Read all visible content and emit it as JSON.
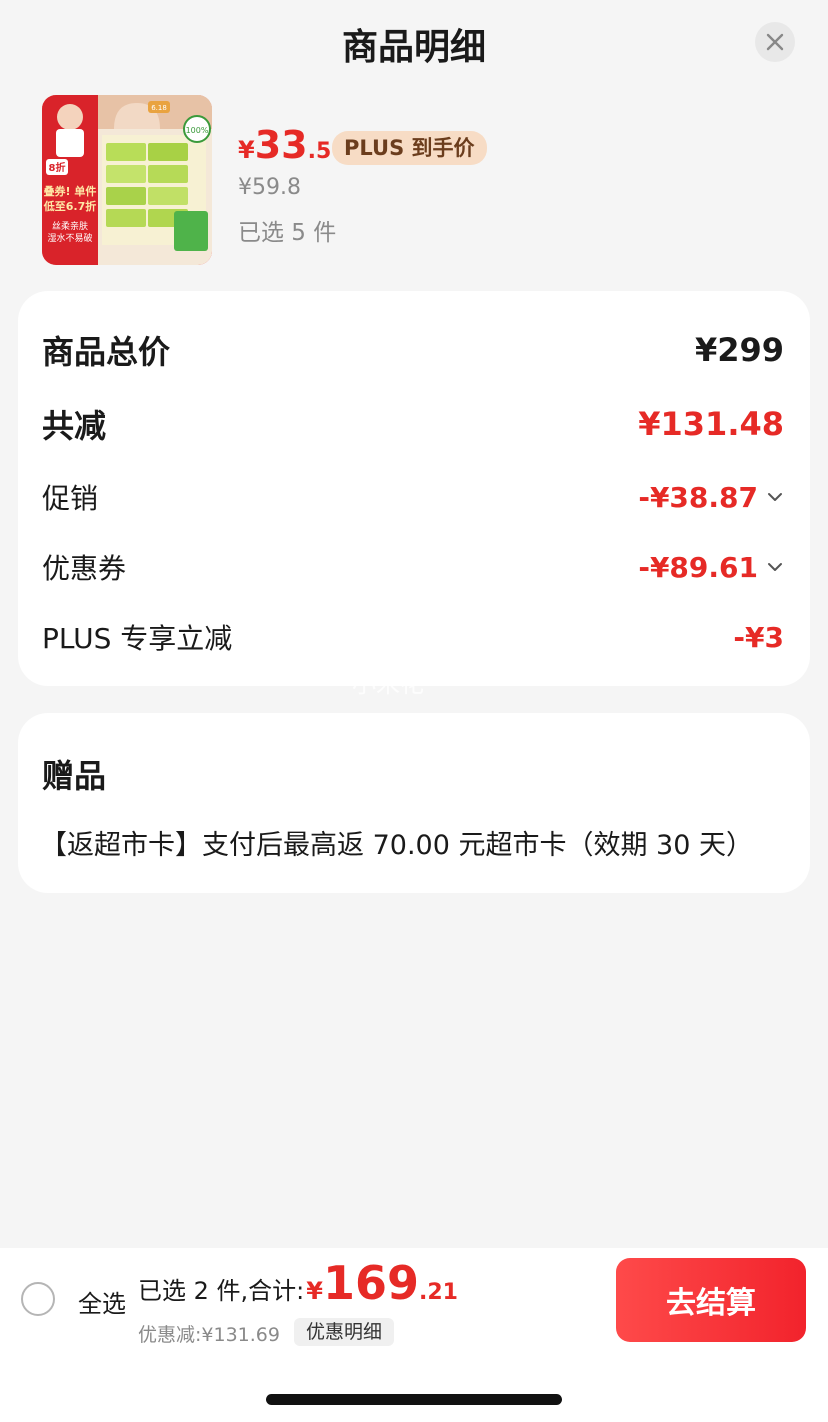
{
  "header": {
    "title": "商品明细"
  },
  "product": {
    "price_symbol": "¥",
    "price_int": "33",
    "price_dec": ".5",
    "plus_badge": "PLUS 到手价",
    "original_price": "¥59.8",
    "selected_qty": "已选 5 件",
    "thumbnail": {
      "banner_top": "6.18",
      "badge_text": "8折",
      "promo_line1": "叠券! 单件",
      "promo_line2": "低至6.7折",
      "bottom_line1": "丝柔亲肤",
      "bottom_line2": "湿水不易破",
      "cert": "100%"
    }
  },
  "summary": {
    "total_label": "商品总价",
    "total_value": "¥299",
    "reduce_label": "共减",
    "reduce_value": "¥131.48",
    "promo_label": "促销",
    "promo_value": "-¥38.87",
    "coupon_label": "优惠券",
    "coupon_value": "-¥89.61",
    "plus_label": "PLUS 专享立减",
    "plus_value": "-¥3"
  },
  "watermark": "小米花",
  "gift": {
    "title": "赠品",
    "text": "【返超市卡】支付后最高返 70.00 元超市卡（效期 30 天）"
  },
  "footer": {
    "select_all": "全选",
    "total_label": "已选 2 件,合计:",
    "total_symbol": "¥",
    "total_int": "169",
    "total_dec": ".21",
    "discount_text": "优惠减:¥131.69",
    "detail_link": "优惠明细",
    "checkout_label": "去结算"
  },
  "colors": {
    "accent": "#e62a26",
    "badge_bg": "#f7dcc5",
    "background": "#f5f5f5"
  }
}
